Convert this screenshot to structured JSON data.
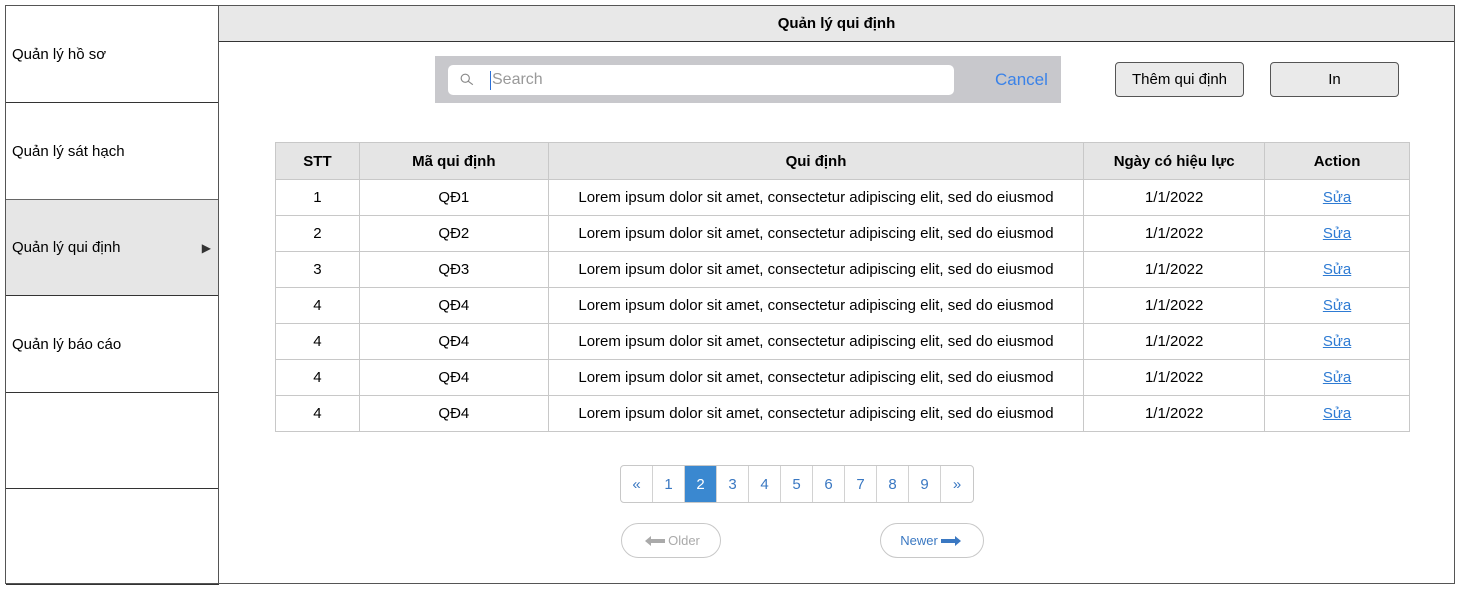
{
  "sidebar": {
    "items": [
      {
        "label": "Quản lý hồ sơ"
      },
      {
        "label": "Quản lý sát hạch"
      },
      {
        "label": "Quản lý qui định",
        "arrow": "▶"
      },
      {
        "label": "Quản lý báo cáo"
      },
      {
        "label": ""
      },
      {
        "label": ""
      }
    ]
  },
  "header": {
    "title": "Quản lý qui định"
  },
  "search": {
    "placeholder": "Search",
    "cancel_label": "Cancel"
  },
  "toolbar": {
    "add_label": "Thêm qui định",
    "print_label": "In"
  },
  "table": {
    "headers": [
      "STT",
      "Mã qui định",
      "Qui định",
      "Ngày có hiệu lực",
      "Action"
    ],
    "rows": [
      {
        "stt": "1",
        "code": "QĐ1",
        "rule": "Lorem ipsum dolor sit amet, consectetur adipiscing elit, sed do eiusmod",
        "date": "1/1/2022",
        "action": "Sửa"
      },
      {
        "stt": "2",
        "code": "QĐ2",
        "rule": "Lorem ipsum dolor sit amet, consectetur adipiscing elit, sed do eiusmod",
        "date": "1/1/2022",
        "action": "Sửa"
      },
      {
        "stt": "3",
        "code": "QĐ3",
        "rule": "Lorem ipsum dolor sit amet, consectetur adipiscing elit, sed do eiusmod",
        "date": "1/1/2022",
        "action": "Sửa"
      },
      {
        "stt": "4",
        "code": "QĐ4",
        "rule": "Lorem ipsum dolor sit amet, consectetur adipiscing elit, sed do eiusmod",
        "date": "1/1/2022",
        "action": "Sửa"
      },
      {
        "stt": "4",
        "code": "QĐ4",
        "rule": "Lorem ipsum dolor sit amet, consectetur adipiscing elit, sed do eiusmod",
        "date": "1/1/2022",
        "action": "Sửa"
      },
      {
        "stt": "4",
        "code": "QĐ4",
        "rule": "Lorem ipsum dolor sit amet, consectetur adipiscing elit, sed do eiusmod",
        "date": "1/1/2022",
        "action": "Sửa"
      },
      {
        "stt": "4",
        "code": "QĐ4",
        "rule": "Lorem ipsum dolor sit amet, consectetur adipiscing elit, sed do eiusmod",
        "date": "1/1/2022",
        "action": "Sửa"
      }
    ]
  },
  "pagination": {
    "prev": "«",
    "pages": [
      "1",
      "2",
      "3",
      "4",
      "5",
      "6",
      "7",
      "8",
      "9"
    ],
    "current": "2",
    "next": "»",
    "older_label": "Older",
    "newer_label": "Newer"
  },
  "colors": {
    "link": "#2e7bd3",
    "active_page": "#3a88d0",
    "cancel": "#3a82e8"
  }
}
